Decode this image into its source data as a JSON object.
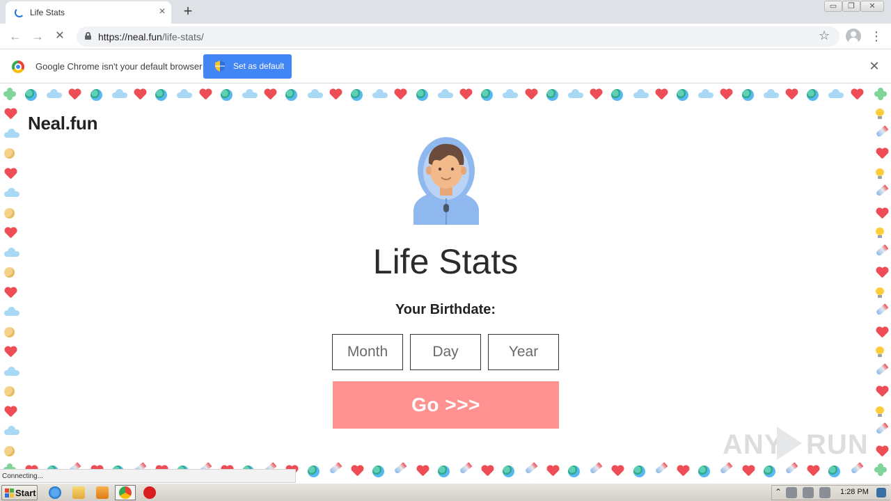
{
  "browser": {
    "tab_title": "Life Stats",
    "tab_close": "×",
    "new_tab": "+",
    "url_host": "https://neal.fun",
    "url_path": "/life-stats/",
    "window_controls": {
      "minimize": "▭",
      "restore": "❐",
      "close": "✕"
    },
    "back": "←",
    "forward": "→",
    "reload": "✕",
    "bookmark": "☆",
    "menu": "⋮"
  },
  "infobar": {
    "message": "Google Chrome isn't your default browser",
    "set_default": "Set as default",
    "close": "✕"
  },
  "page": {
    "brand": "Neal.fun",
    "title": "Life Stats",
    "birthdate_label": "Your Birthdate:",
    "month_placeholder": "Month",
    "day_placeholder": "Day",
    "year_placeholder": "Year",
    "go_label": "Go >>>",
    "go_color": "#ff9191",
    "watermark_left": "ANY",
    "watermark_right": "RUN"
  },
  "status_bar": {
    "text": "Connecting..."
  },
  "taskbar": {
    "start_label": "Start",
    "clock": "1:28 PM",
    "tray_expand": "⌃"
  },
  "border_icons": [
    "heart-icon",
    "globe-icon",
    "cloud-icon",
    "moon-icon",
    "lightbulb-icon",
    "rocket-icon",
    "clover-icon"
  ]
}
